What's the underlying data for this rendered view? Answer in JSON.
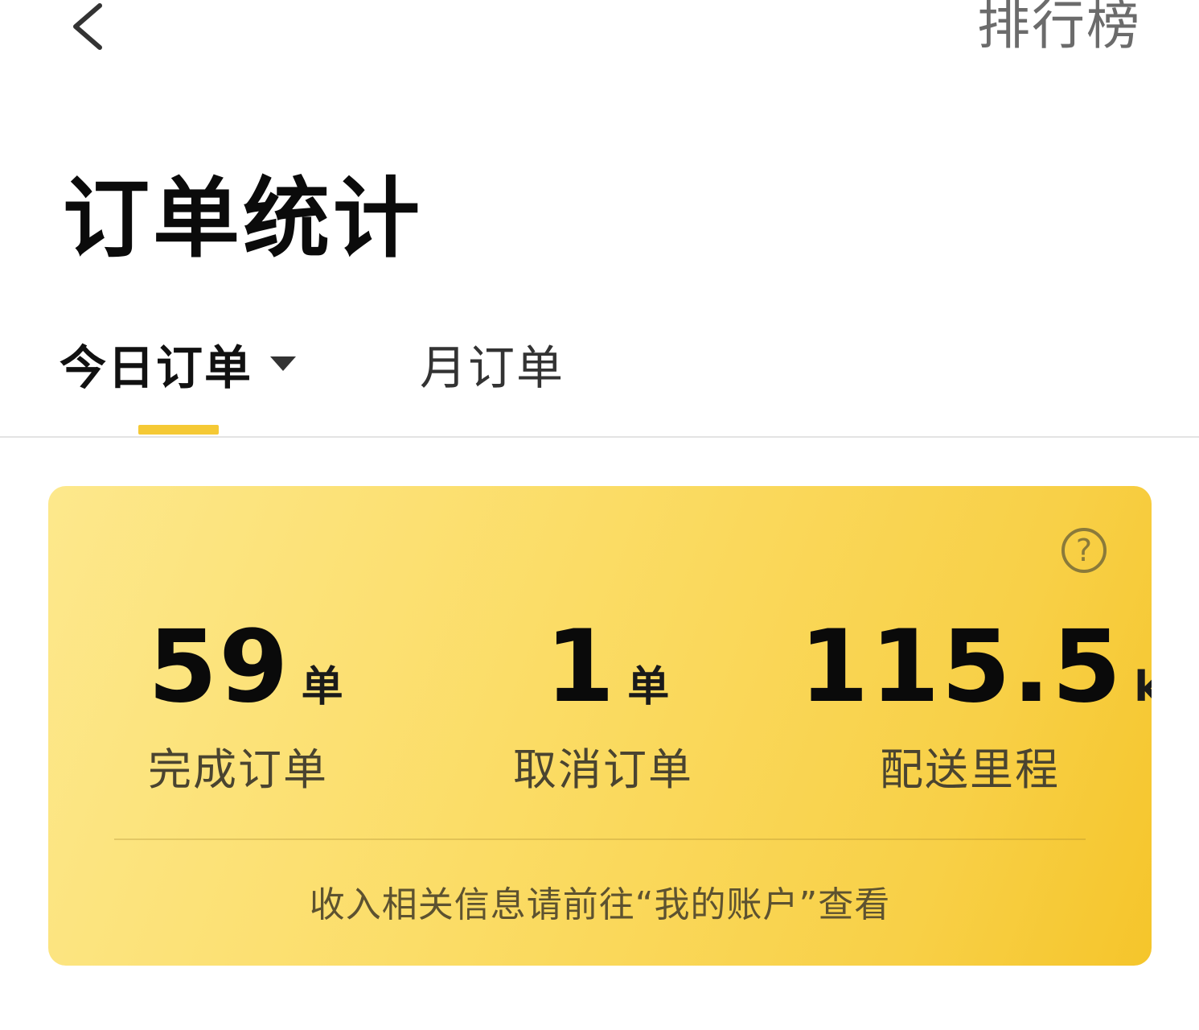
{
  "header": {
    "back_icon": "chevron-left-icon",
    "leaderboard_label": "排行榜"
  },
  "page": {
    "title": "订单统计"
  },
  "tabs": [
    {
      "label": "今日订单",
      "active": true,
      "has_dropdown": true
    },
    {
      "label": "月订单",
      "active": false
    }
  ],
  "stats_card": {
    "help_icon": "question-circle-icon",
    "help_glyph": "?",
    "completed": {
      "value": "59",
      "unit": "单",
      "label": "完成订单"
    },
    "cancelled": {
      "value": "1",
      "unit": "单",
      "label": "取消订单"
    },
    "distance": {
      "value": "115.5",
      "unit": "km",
      "label": "配送里程"
    },
    "note": "收入相关信息请前往“我的账户”查看"
  },
  "colors": {
    "accent": "#f5c935",
    "card_gradient_start": "#fde88c",
    "card_gradient_end": "#f5c52b"
  }
}
